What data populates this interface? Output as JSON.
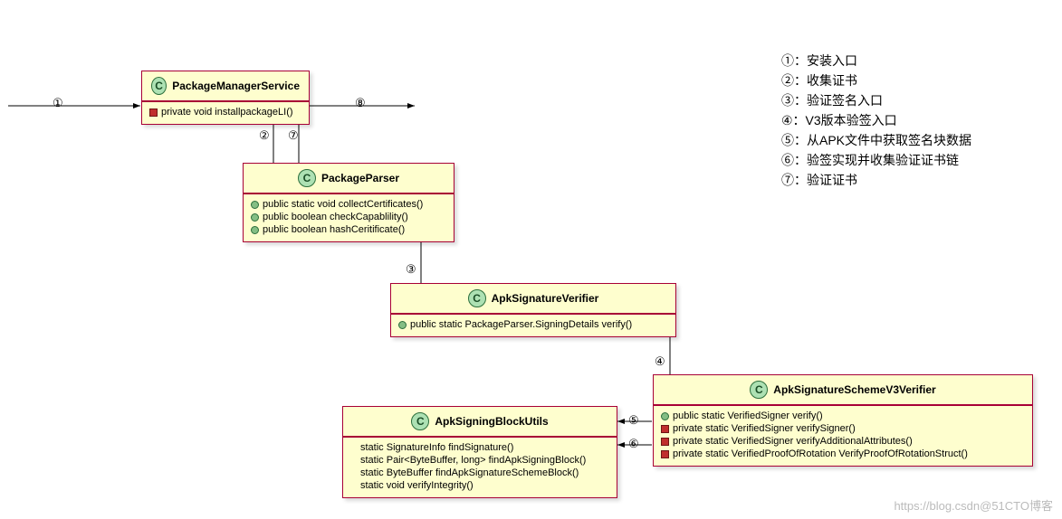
{
  "legend": {
    "items": [
      "①：安装入口",
      "②：收集证书",
      "③：验证签名入口",
      "④：V3版本验签入口",
      "⑤：从APK文件中获取签名块数据",
      "⑥：验签实现并收集验证证书链",
      "⑦：验证证书"
    ]
  },
  "classes": {
    "pms": {
      "name": "PackageManagerService",
      "members": [
        {
          "vis": "priv",
          "sig": "private void installpackageLI()"
        }
      ]
    },
    "pp": {
      "name": "PackageParser",
      "members": [
        {
          "vis": "pub",
          "sig": "public static void collectCertificates()"
        },
        {
          "vis": "pub",
          "sig": "public boolean checkCapablility()"
        },
        {
          "vis": "pub",
          "sig": "public boolean hashCeritificate()"
        }
      ]
    },
    "asv": {
      "name": "ApkSignatureVerifier",
      "members": [
        {
          "vis": "pub",
          "sig": "public static PackageParser.SigningDetails verify()"
        }
      ]
    },
    "assv3": {
      "name": "ApkSignatureSchemeV3Verifier",
      "members": [
        {
          "vis": "pub",
          "sig": "public static VerifiedSigner verify()"
        },
        {
          "vis": "priv",
          "sig": "private static VerifiedSigner verifySigner()"
        },
        {
          "vis": "priv",
          "sig": "private static VerifiedSigner verifyAdditionalAttributes()"
        },
        {
          "vis": "priv",
          "sig": "private static VerifiedProofOfRotation VerifyProofOfRotationStruct()"
        }
      ]
    },
    "asbu": {
      "name": "ApkSigningBlockUtils",
      "members": [
        {
          "vis": "def",
          "sig": "static SignatureInfo findSignature()"
        },
        {
          "vis": "def",
          "sig": "static Pair<ByteBuffer, long> findApkSigningBlock()"
        },
        {
          "vis": "def",
          "sig": "static ByteBuffer findApkSignatureSchemeBlock()"
        },
        {
          "vis": "def",
          "sig": "static void verifyIntegrity()"
        }
      ]
    }
  },
  "edges": {
    "e1": "①",
    "e2": "②",
    "e3": "③",
    "e4": "④",
    "e5": "⑤",
    "e6": "⑥",
    "e7": "⑦",
    "e8": "⑧"
  },
  "watermark": "https://blog.csdn@51CTO博客"
}
